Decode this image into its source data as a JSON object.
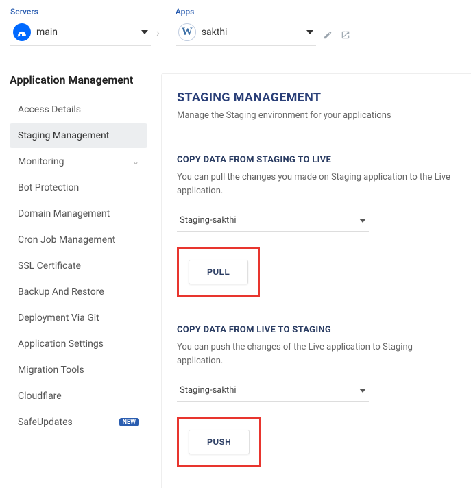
{
  "breadcrumb": {
    "servers_label": "Servers",
    "server_selected": "main",
    "apps_label": "Apps",
    "app_selected": "sakthi"
  },
  "sidebar": {
    "heading": "Application Management",
    "items": [
      {
        "label": "Access Details",
        "active": false
      },
      {
        "label": "Staging Management",
        "active": true
      },
      {
        "label": "Monitoring",
        "active": false,
        "expandable": true
      },
      {
        "label": "Bot Protection",
        "active": false
      },
      {
        "label": "Domain Management",
        "active": false
      },
      {
        "label": "Cron Job Management",
        "active": false
      },
      {
        "label": "SSL Certificate",
        "active": false
      },
      {
        "label": "Backup And Restore",
        "active": false
      },
      {
        "label": "Deployment Via Git",
        "active": false
      },
      {
        "label": "Application Settings",
        "active": false
      },
      {
        "label": "Migration Tools",
        "active": false
      },
      {
        "label": "Cloudflare",
        "active": false
      },
      {
        "label": "SafeUpdates",
        "active": false,
        "badge": "NEW"
      }
    ]
  },
  "main": {
    "title": "STAGING MANAGEMENT",
    "subtitle": "Manage the Staging environment for your applications",
    "pull": {
      "title": "COPY DATA FROM STAGING TO LIVE",
      "desc": "You can pull the changes you made on Staging application to the Live application.",
      "selected": "Staging-sakthi",
      "button": "PULL"
    },
    "push": {
      "title": "COPY DATA FROM LIVE TO STAGING",
      "desc": "You can push the changes of the Live application to Staging application.",
      "selected": "Staging-sakthi",
      "button": "PUSH"
    }
  }
}
